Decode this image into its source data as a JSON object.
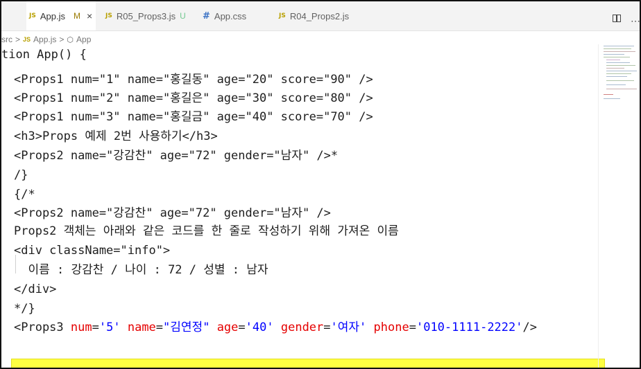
{
  "tabs": [
    {
      "icon": "JS",
      "label": "App.js",
      "status": "M",
      "close": "×"
    },
    {
      "icon": "JS",
      "label": "R05_Props3.js",
      "status": "U"
    },
    {
      "icon": "#",
      "label": "App.css"
    },
    {
      "icon": "JS",
      "label": "R04_Props2.js"
    }
  ],
  "breadcrumb": {
    "folder": "src",
    "sep": ">",
    "file_icon": "JS",
    "file": "App.js",
    "symbol_icon": "⬡",
    "symbol": "App"
  },
  "code": {
    "header": "tion App() {",
    "l1_tag": "<Props1",
    "l1_rest": " num=\"1\" name=\"홍길동\" age=\"20\" score=\"90\" />",
    "l2_tag": "<Props1",
    "l2_rest": " num=\"2\" name=\"홍길은\" age=\"30\" score=\"80\" />",
    "l3_tag": "<Props1",
    "l3_rest": " num=\"3\" name=\"홍길금\" age=\"40\" score=\"70\" />",
    "l4": "<h3>Props 예제 2번 사용하기</h3>",
    "l5": "<Props2 name=\"강감찬\" age=\"72\" gender=\"남자\" />*",
    "l6": "/}",
    "l7": "{/*",
    "l8": "<Props2 name=\"강감찬\" age=\"72\" gender=\"남자\" />",
    "l9": "Props2 객체는 아래와 같은 코드를 한 줄로 작성하기 위해 가져온 이름",
    "l10": "<div className=\"info\">",
    "l11": "  이름 : 강감찬 / 나이 : 72 / 성별 : 남자",
    "l12": "</div>",
    "l13": "*/}",
    "l14_tag": "<Props3",
    "l14_a1": "num",
    "l14_v1": "'5'",
    "l14_a2": "name",
    "l14_v2": "\"김연정\"",
    "l14_a3": "age",
    "l14_v3": "'40'",
    "l14_a4": "gender",
    "l14_v4": "'여자'",
    "l14_a5": "phone",
    "l14_v5": "'010-1111-2222'",
    "l14_end": "/>"
  },
  "colors": {
    "highlight": "#ffff42",
    "attribute": "#e50000",
    "string": "#0000ff"
  },
  "icons": {
    "split": "split-editor-icon",
    "more": "more-actions-icon"
  }
}
